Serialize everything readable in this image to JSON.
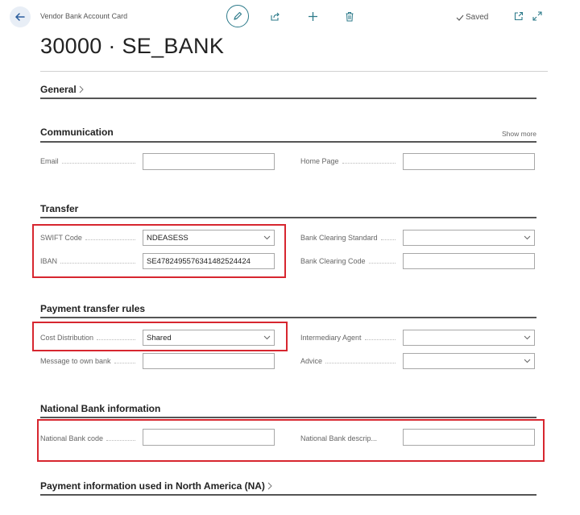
{
  "header": {
    "caption": "Vendor Bank Account Card",
    "saved_label": "Saved",
    "title": "30000 · SE_BANK"
  },
  "general": {
    "title": "General"
  },
  "communication": {
    "title": "Communication",
    "show_more": "Show more",
    "email_label": "Email",
    "email_value": "",
    "home_page_label": "Home Page",
    "home_page_value": ""
  },
  "transfer": {
    "title": "Transfer",
    "swift_label": "SWIFT Code",
    "swift_value": "NDEASESS",
    "iban_label": "IBAN",
    "iban_value": "SE4782495576341482524424",
    "clearing_standard_label": "Bank Clearing Standard",
    "clearing_standard_value": "",
    "clearing_code_label": "Bank Clearing Code",
    "clearing_code_value": ""
  },
  "payment_rules": {
    "title": "Payment transfer rules",
    "cost_label": "Cost Distribution",
    "cost_value": "Shared",
    "message_label": "Message to own bank",
    "message_value": "",
    "intermediary_label": "Intermediary Agent",
    "intermediary_value": "",
    "advice_label": "Advice",
    "advice_value": ""
  },
  "national_bank": {
    "title": "National Bank information",
    "code_label": "National Bank code",
    "code_value": "",
    "desc_label": "National Bank descrip...",
    "desc_value": ""
  },
  "north_america": {
    "title": "Payment information used in North America (NA)"
  },
  "colors": {
    "accent": "#2c7a8a",
    "highlight": "#d7262f",
    "back_bg": "#e8eef6"
  }
}
